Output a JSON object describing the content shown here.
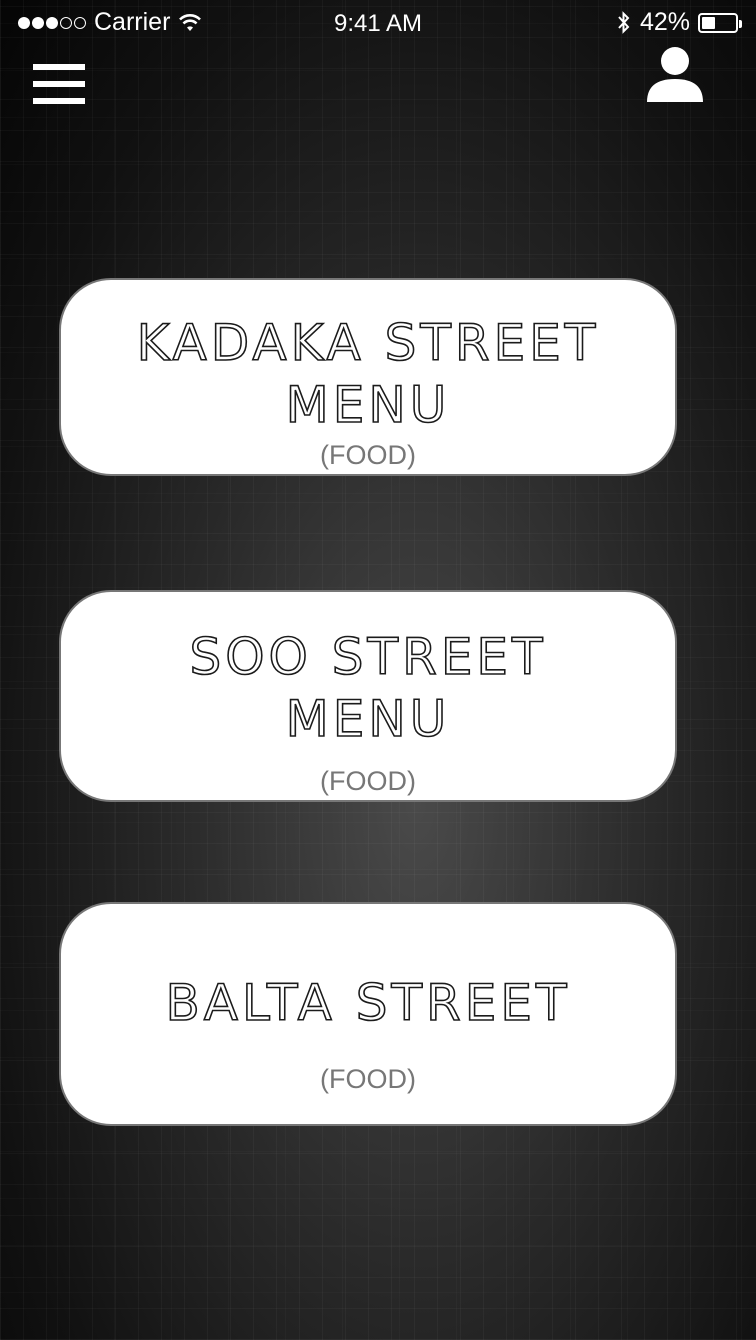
{
  "status_bar": {
    "carrier": "Carrier",
    "time": "9:41 AM",
    "battery_text": "42%",
    "battery_level": 0.42
  },
  "header": {
    "menu_icon": "hamburger-icon",
    "profile_icon": "user-icon"
  },
  "menus": [
    {
      "title": "KADAKA STREET MENU",
      "subtitle": "(FOOD)"
    },
    {
      "title": "SOO STREET MENU",
      "subtitle": "(FOOD)"
    },
    {
      "title": "BALTA STREET",
      "subtitle": "(FOOD)"
    }
  ],
  "colors": {
    "card_background": "#ffffff",
    "title_text": "#1b1b1b",
    "subtitle_text": "#777777",
    "icon": "#ffffff"
  }
}
